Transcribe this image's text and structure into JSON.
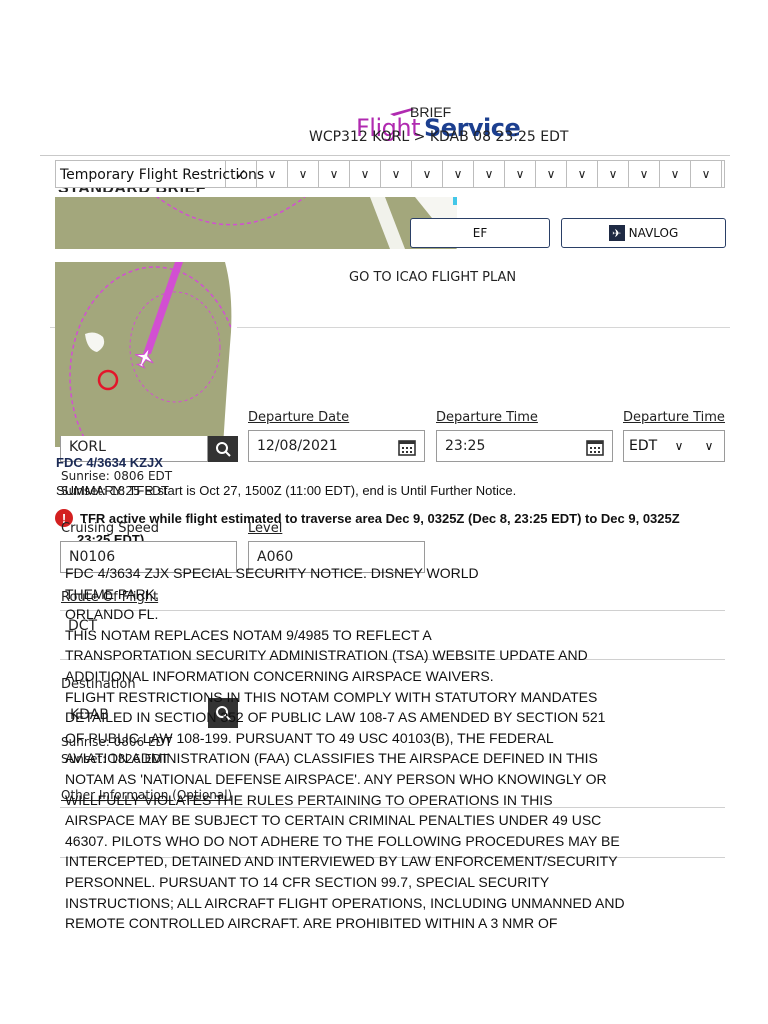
{
  "header": {
    "logo_brief": "BRIEF",
    "logo_flight": "Flight",
    "logo_service": "Service",
    "route_title": "WCP312 KORL > KDAB 08 23:25 EDT"
  },
  "filter_bar": {
    "selected_label": "Temporary Flight Restrictions",
    "check": "✓",
    "chevron": "∨"
  },
  "standard_brief_title": "STANDARD BRIEF",
  "buttons": {
    "brief_label": "EF",
    "navlog_label": "NAVLOG",
    "icao_link": "GO TO ICAO FLIGHT PLAN"
  },
  "departure": {
    "date_label": "Departure Date",
    "date_value": "12/08/2021",
    "time_label": "Departure Time",
    "time_value": "23:25",
    "tz_label": "Departure Time Z",
    "tz_value": "EDT",
    "airport_value": "KORL",
    "sunrise": "Sunrise:  0806 EDT",
    "sunset": "Sunset:  1825 EDT"
  },
  "notam": {
    "id": "FDC 4/3634 KZJX",
    "summary": "SUMMARY: TFR start is Oct 27, 1500Z (11:00 EDT), end is Until Further Notice.",
    "active_line1": "TFR active while flight estimated to traverse area Dec 9, 0325Z (Dec 8, 23:25 EDT) to Dec 9, 0325Z",
    "active_line2": "23:25 EDT).",
    "body": "FDC 4/3634 ZJX SPECIAL SECURITY NOTICE. DISNEY WORLD\nTHEME PARK,\nORLANDO FL.\nTHIS NOTAM REPLACES NOTAM 9/4985 TO REFLECT A\nTRANSPORTATION SECURITY ADMINISTRATION (TSA) WEBSITE UPDATE AND\nADDITIONAL INFORMATION CONCERNING AIRSPACE WAIVERS.\nFLIGHT RESTRICTIONS IN THIS NOTAM COMPLY WITH STATUTORY MANDATES\nDETAILED IN SECTION 352 OF PUBLIC LAW 108-7 AS AMENDED BY SECTION 521\nOF PUBLIC LAW 108-199. PURSUANT TO 49 USC 40103(B), THE FEDERAL\nAVIATION ADMINISTRATION (FAA) CLASSIFIES THE AIRSPACE DEFINED IN THIS\nNOTAM AS 'NATIONAL DEFENSE AIRSPACE'. ANY PERSON WHO KNOWINGLY OR\nWILLFULLY VIOLATES THE RULES PERTAINING TO OPERATIONS IN THIS\nAIRSPACE MAY BE SUBJECT TO CERTAIN CRIMINAL PENALTIES UNDER 49 USC\n46307. PILOTS WHO DO NOT ADHERE TO THE FOLLOWING PROCEDURES MAY BE\nINTERCEPTED, DETAINED AND INTERVIEWED BY LAW ENFORCEMENT/SECURITY\nPERSONNEL. PURSUANT TO 14 CFR SECTION 99.7, SPECIAL SECURITY\nINSTRUCTIONS; ALL AIRCRAFT FLIGHT OPERATIONS, INCLUDING UNMANNED AND\nREMOTE CONTROLLED AIRCRAFT, ARE PROHIBITED WITHIN A 3 NMR OF"
  },
  "cruise": {
    "speed_label": "Cruising Speed",
    "speed_value": "N0106",
    "level_label": "Level",
    "level_value": "A060"
  },
  "route": {
    "label": "Route Of Flight",
    "value": "DCT"
  },
  "destination": {
    "label": "Destination",
    "value": "KDAB",
    "sunrise": "Sunrise:  0806 EDT",
    "sunset": "Sunset:  1826 EDT"
  },
  "other_info": {
    "label": "Other Information (Optional)"
  },
  "colors": {
    "flight_magenta": "#b02ab0",
    "service_blue": "#1c3f8f",
    "map_land": "#a3a77c",
    "warning_red": "#d32020"
  }
}
